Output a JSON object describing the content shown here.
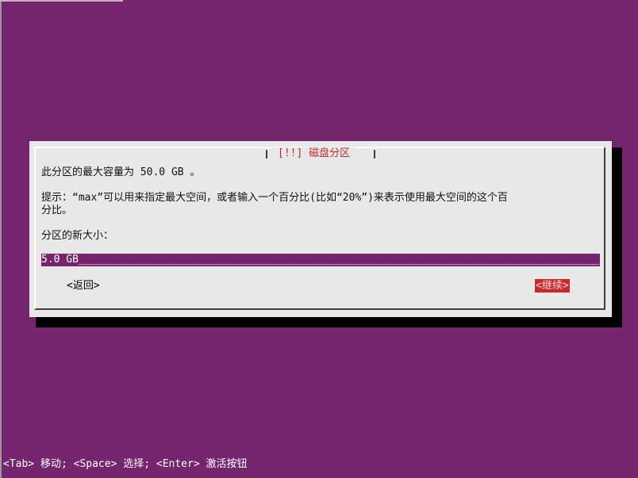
{
  "dialog": {
    "title": "[!!] 磁盘分区",
    "max_line": "此分区的最大容量为 50.0 GB 。",
    "hint_line1": "提示：“max”可以用来指定最大空间，或者输入一个百分比(比如“20%”)来表示使用最大空间的这个百",
    "hint_line2": "分比。",
    "new_size_label": "分区的新大小：",
    "input_value": "5.0 GB",
    "input_fill": "______________________________________________________________________________________",
    "back_button": "<返回>",
    "continue_button": "<继续>"
  },
  "help_bar": {
    "text": "<Tab> 移动; <Space> 选择; <Enter> 激活按钮"
  },
  "colors": {
    "background": "#74256e",
    "dialog": "#e8e8e8",
    "accent": "#c62b2b",
    "shadow": "#000000"
  }
}
